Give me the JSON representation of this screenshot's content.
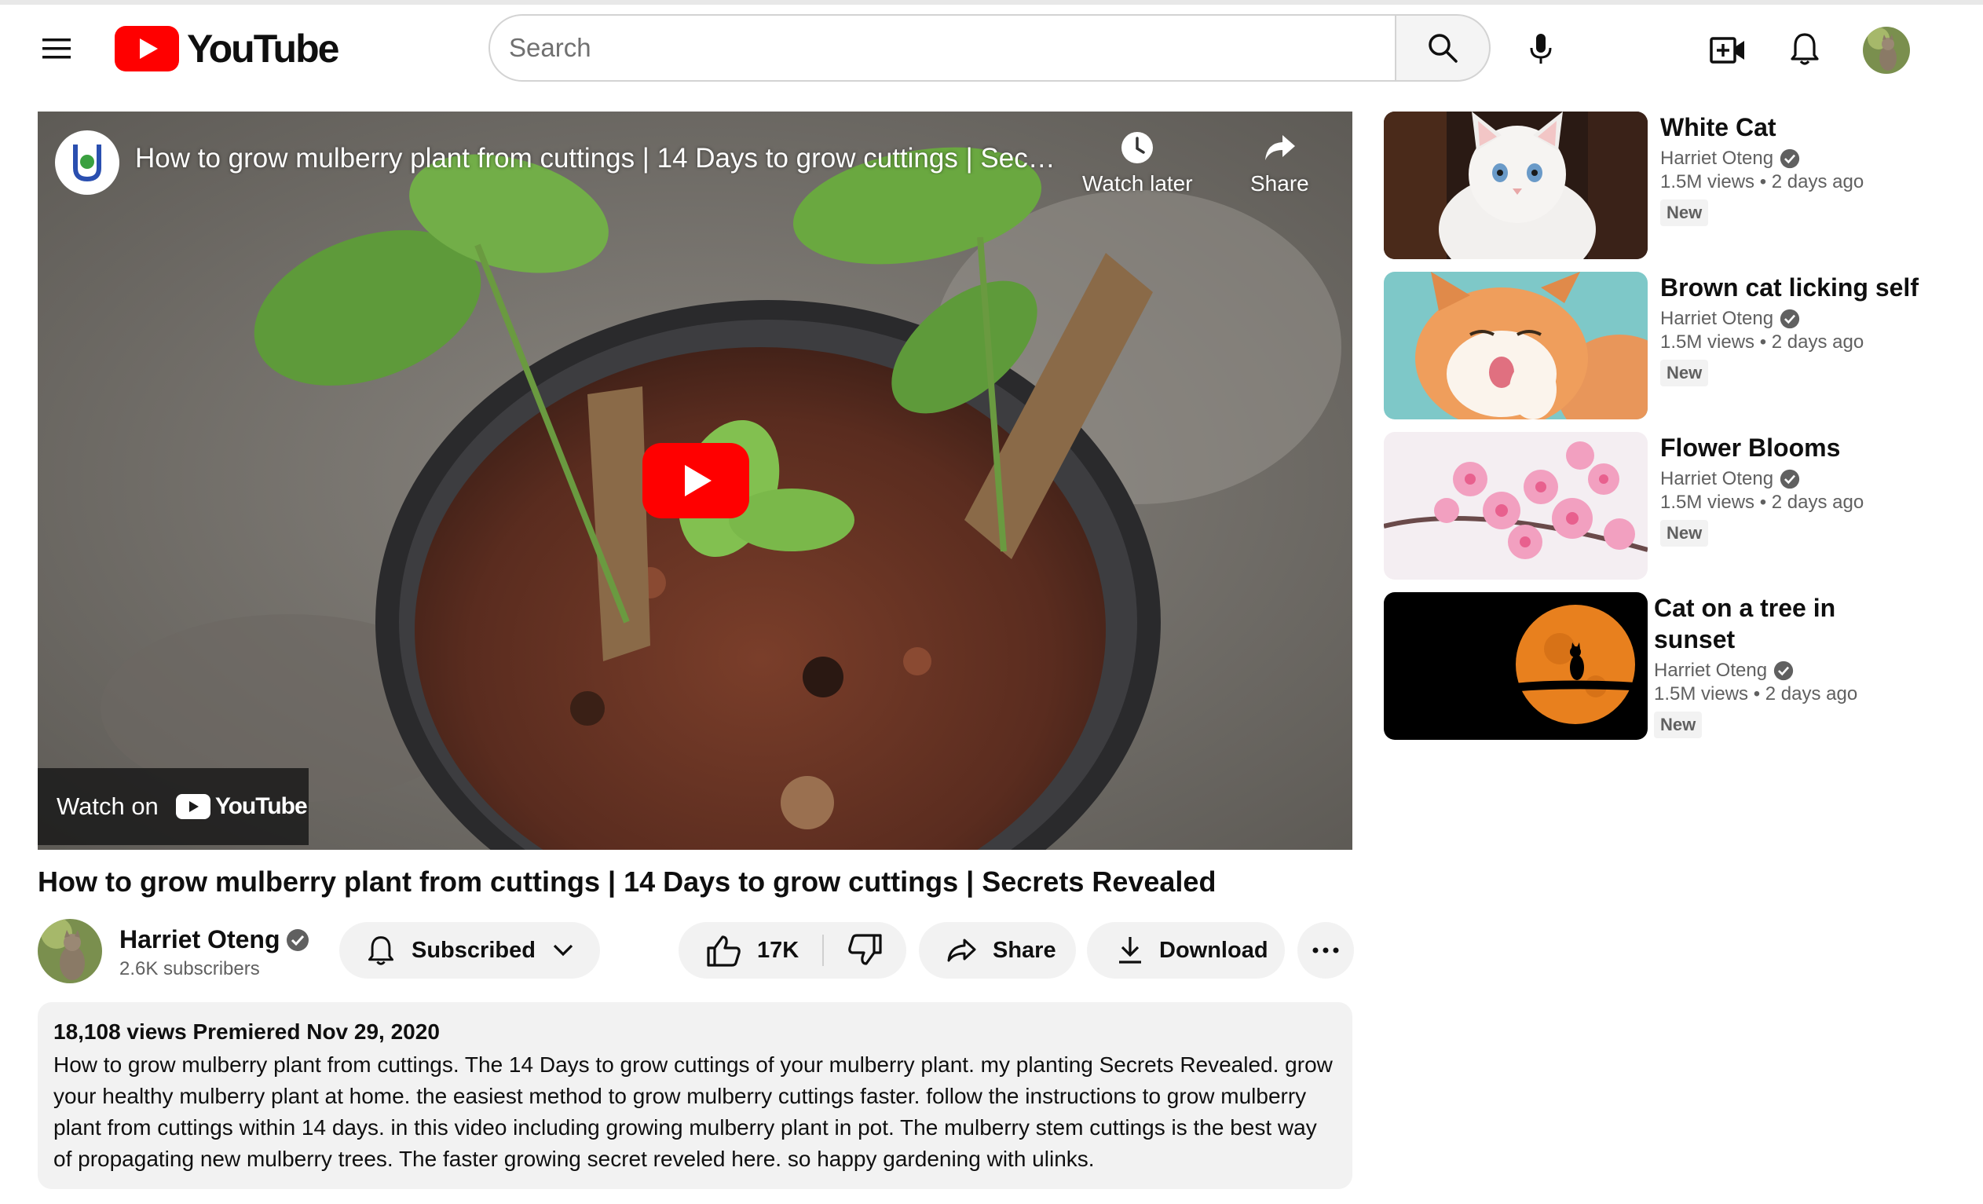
{
  "header": {
    "logo_text": "YouTube",
    "search_placeholder": "Search"
  },
  "player": {
    "overlay_title": "How to grow mulberry plant from cuttings | 14 Days to grow cuttings | Sec…",
    "watch_later_label": "Watch later",
    "share_label": "Share",
    "watch_on_label": "Watch on",
    "watch_on_brand": "YouTube"
  },
  "video": {
    "title": "How to grow mulberry plant from cuttings | 14 Days to grow cuttings | Secrets Revealed",
    "channel_name": "Harriet Oteng",
    "subscribers": "2.6K subscribers",
    "subscribed_label": "Subscribed",
    "likes": "17K",
    "share_label": "Share",
    "download_label": "Download",
    "description_meta": "18,108 views Premiered Nov 29, 2020",
    "description": "How to grow mulberry plant from cuttings. The 14 Days to grow cuttings of your mulberry plant. my planting Secrets Revealed. grow your healthy mulberry plant at home. the easiest method to grow mulberry cuttings faster. follow the instructions to grow mulberry plant from cuttings within 14 days. in this video including growing mulberry plant in pot. The mulberry stem cuttings is the best way of propagating new mulberry trees. The faster growing secret reveled here. so happy gardening with ulinks."
  },
  "sidebar": {
    "items": [
      {
        "title": "White Cat",
        "channel": "Harriet Oteng",
        "meta": "1.5M views • 2 days ago",
        "badge": "New"
      },
      {
        "title": "Brown cat licking self",
        "channel": "Harriet Oteng",
        "meta": "1.5M views • 2 days ago",
        "badge": "New"
      },
      {
        "title": "Flower Blooms",
        "channel": "Harriet Oteng",
        "meta": "1.5M views • 2 days ago",
        "badge": "New"
      },
      {
        "title": "Cat on a tree in sunset",
        "channel": "Harriet Oteng",
        "meta": "1.5M views • 2 days ago",
        "badge": "New"
      }
    ]
  },
  "colors": {
    "brand_red": "#ff0000",
    "text_primary": "#0f0f0f",
    "text_secondary": "#606060",
    "pill_bg": "#f2f2f2"
  }
}
